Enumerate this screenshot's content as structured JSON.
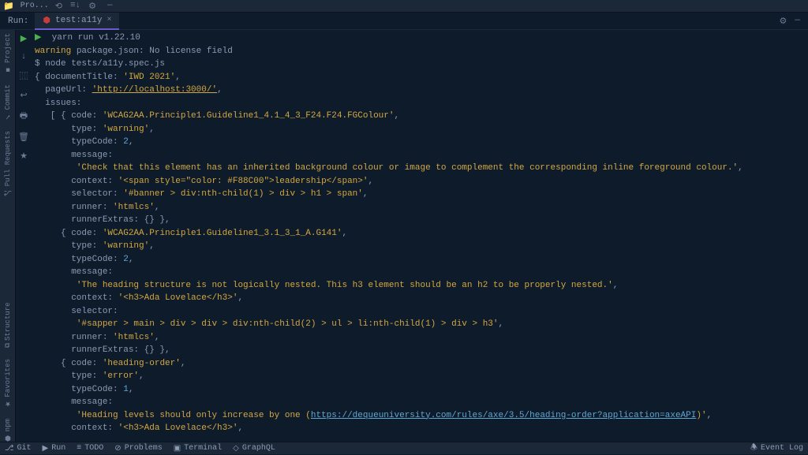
{
  "topbar": {
    "project": "Pro..."
  },
  "run": {
    "label": "Run:",
    "tab_name": "test:a11y"
  },
  "left_rail": {
    "project": "Project",
    "commit": "Commit",
    "pull": "Pull Requests",
    "structure": "Structure",
    "favorites": "Favorites",
    "npm": "npm"
  },
  "console": {
    "l0_play": "▶",
    "l0": "  yarn run v1.22.10",
    "l1_prefix": "warning",
    "l1_rest": " package.json: No license field",
    "l2_prompt": "$ ",
    "l2_cmd": "node tests/a11y.spec.js",
    "l3": "{ documentTitle: ",
    "l3_str": "'IWD 2021'",
    "l3_end": ",",
    "l4": "  pageUrl: ",
    "l4_url": "'http://localhost:3000/'",
    "l4_end": ",",
    "l5": "  issues:",
    "l6": "   [ { code: ",
    "l6_str": "'WCAG2AA.Principle1.Guideline1_4.1_4_3_F24.F24.FGColour'",
    "l6_end": ",",
    "l7": "       type: ",
    "l7_str": "'warning'",
    "l7_end": ",",
    "l8": "       typeCode: ",
    "l8_num": "2",
    "l8_end": ",",
    "l9": "       message:",
    "l10": "        ",
    "l10_str": "'Check that this element has an inherited background colour or image to complement the corresponding inline foreground colour.'",
    "l10_end": ",",
    "l11": "       context: ",
    "l11_str": "'<span style=\"color: #F88C00\">leadership</span>'",
    "l11_end": ",",
    "l12": "       selector: ",
    "l12_str": "'#banner > div:nth-child(1) > div > h1 > span'",
    "l12_end": ",",
    "l13": "       runner: ",
    "l13_str": "'htmlcs'",
    "l13_end": ",",
    "l14": "       runnerExtras: {} },",
    "l15": "     { code: ",
    "l15_str": "'WCAG2AA.Principle1.Guideline1_3.1_3_1_A.G141'",
    "l15_end": ",",
    "l16": "       type: ",
    "l16_str": "'warning'",
    "l16_end": ",",
    "l17": "       typeCode: ",
    "l17_num": "2",
    "l17_end": ",",
    "l18": "       message:",
    "l19": "        ",
    "l19_str": "'The heading structure is not logically nested. This h3 element should be an h2 to be properly nested.'",
    "l19_end": ",",
    "l20": "       context: ",
    "l20_str": "'<h3>Ada Lovelace</h3>'",
    "l20_end": ",",
    "l21": "       selector:",
    "l22": "        ",
    "l22_str": "'#sapper > main > div > div > div:nth-child(2) > ul > li:nth-child(1) > div > h3'",
    "l22_end": ",",
    "l23": "       runner: ",
    "l23_str": "'htmlcs'",
    "l23_end": ",",
    "l24": "       runnerExtras: {} },",
    "l25": "     { code: ",
    "l25_str": "'heading-order'",
    "l25_end": ",",
    "l26": "       type: ",
    "l26_str": "'error'",
    "l26_end": ",",
    "l27": "       typeCode: ",
    "l27_num": "1",
    "l27_end": ",",
    "l28": "       message:",
    "l29": "        ",
    "l29_str": "'Heading levels should only increase by one (",
    "l29_link": "https://dequeuniversity.com/rules/axe/3.5/heading-order?application=axeAPI",
    "l29_str2": ")'",
    "l29_end": ",",
    "l30": "       context: ",
    "l30_str": "'<h3>Ada Lovelace</h3>'",
    "l30_end": ","
  },
  "bottombar": {
    "git": "Git",
    "run": "Run",
    "todo": "TODO",
    "problems": "Problems",
    "terminal": "Terminal",
    "graphql": "GraphQL",
    "eventlog": "Event Log"
  }
}
